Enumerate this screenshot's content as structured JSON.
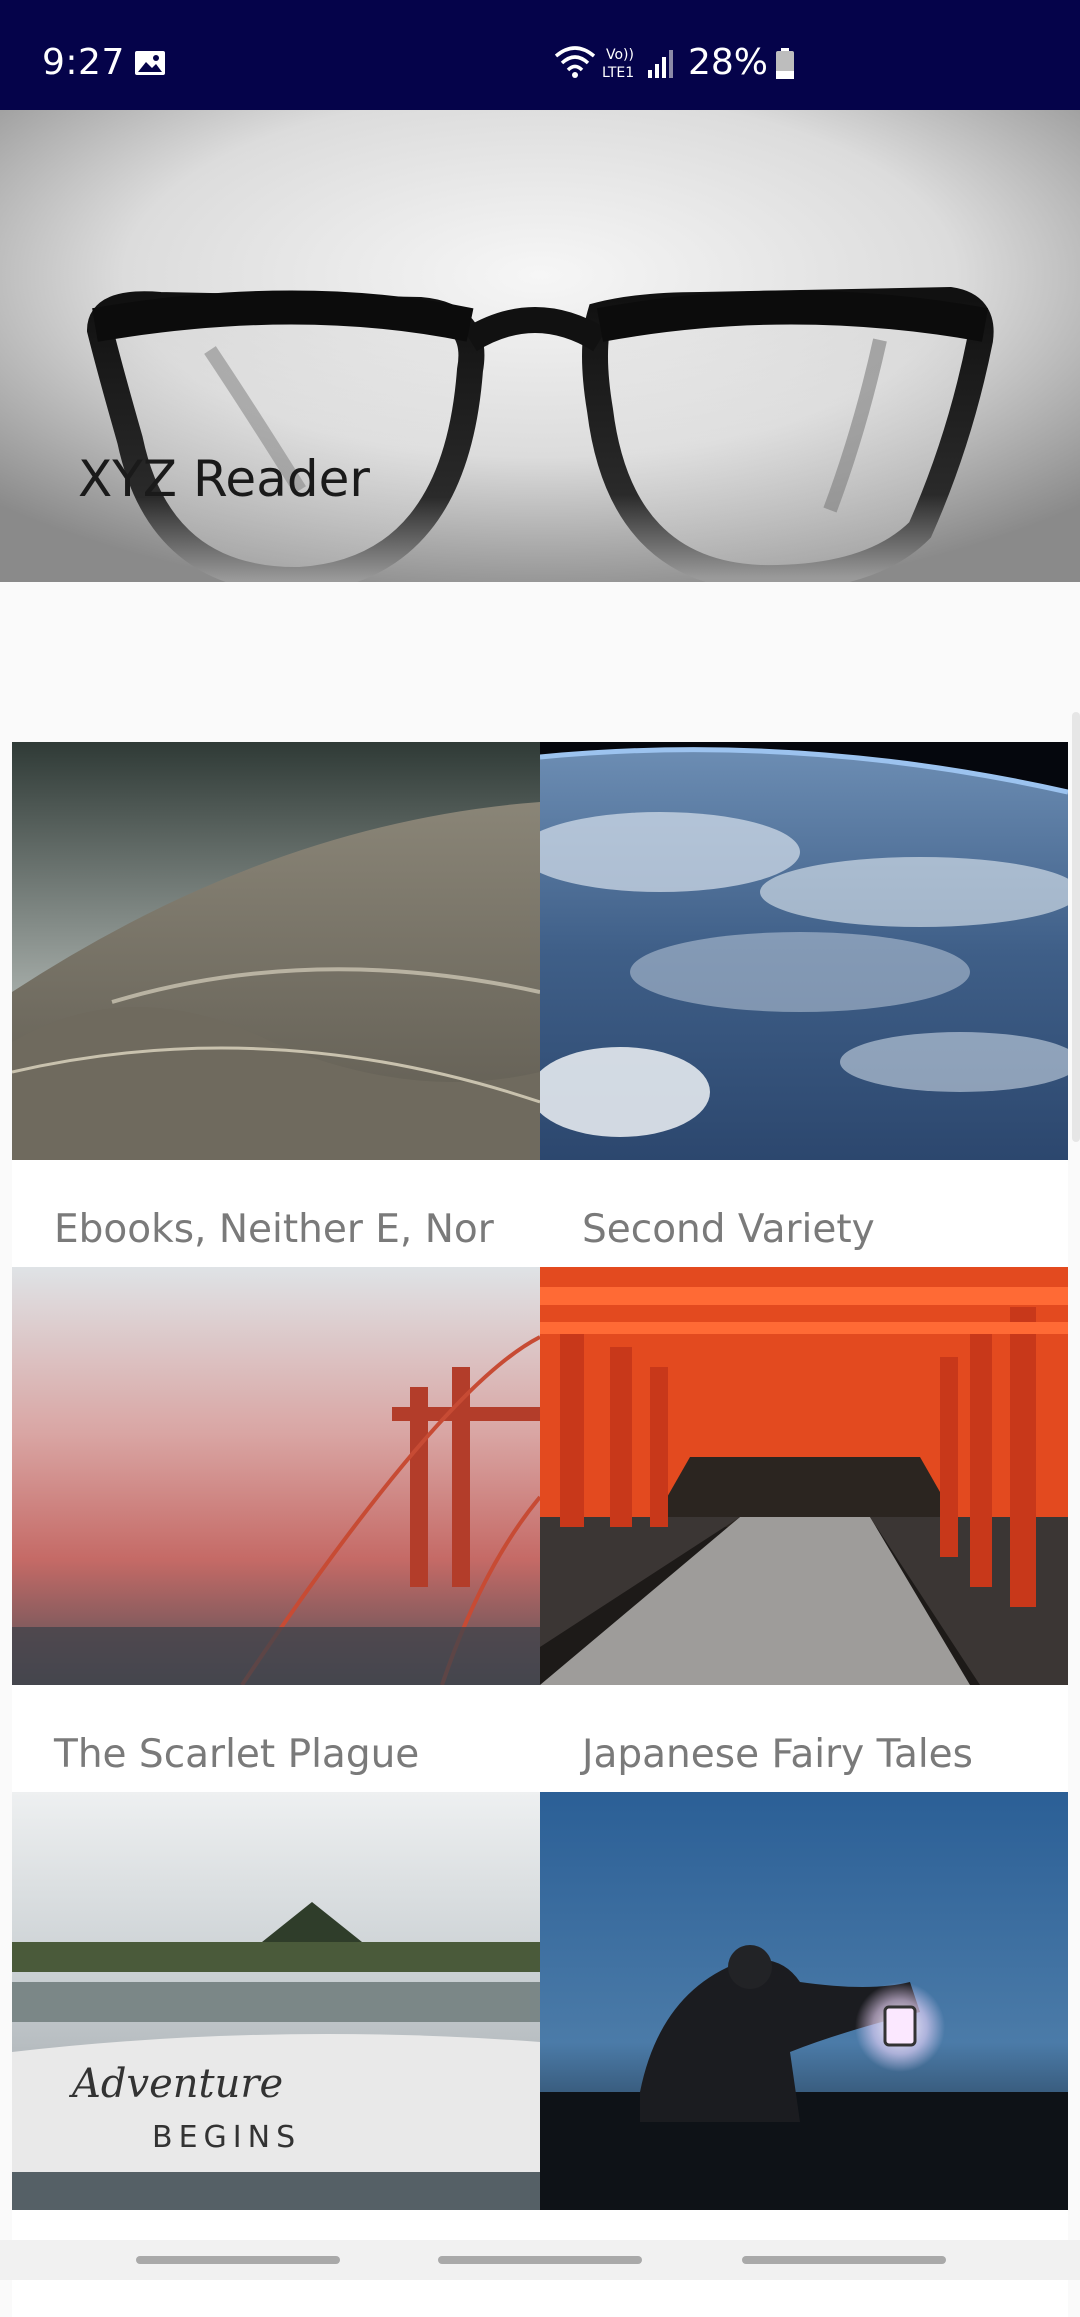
{
  "status_bar": {
    "time": "9:27",
    "battery": "28%",
    "icons": [
      "image-icon",
      "wifi-icon",
      "volte-lte-icon",
      "signal-icon",
      "battery-icon"
    ]
  },
  "header": {
    "title": "XYZ Reader"
  },
  "articles": [
    {
      "title": "Ebooks, Neither E, Nor",
      "image": "opera-house-roof"
    },
    {
      "title": "Second Variety",
      "image": "earth-from-space"
    },
    {
      "title": "The Scarlet Plague",
      "image": "bridge-in-red-fog"
    },
    {
      "title": "Japanese Fairy Tales",
      "image": "torii-gate-tunnel"
    },
    {
      "title": "",
      "image": "adventure-begins-mug"
    },
    {
      "title": "",
      "image": "person-with-lantern"
    }
  ],
  "colors": {
    "status_bar": "#05034a",
    "background": "#fafafa",
    "card": "#ffffff",
    "title_text": "#7a7a7a"
  }
}
